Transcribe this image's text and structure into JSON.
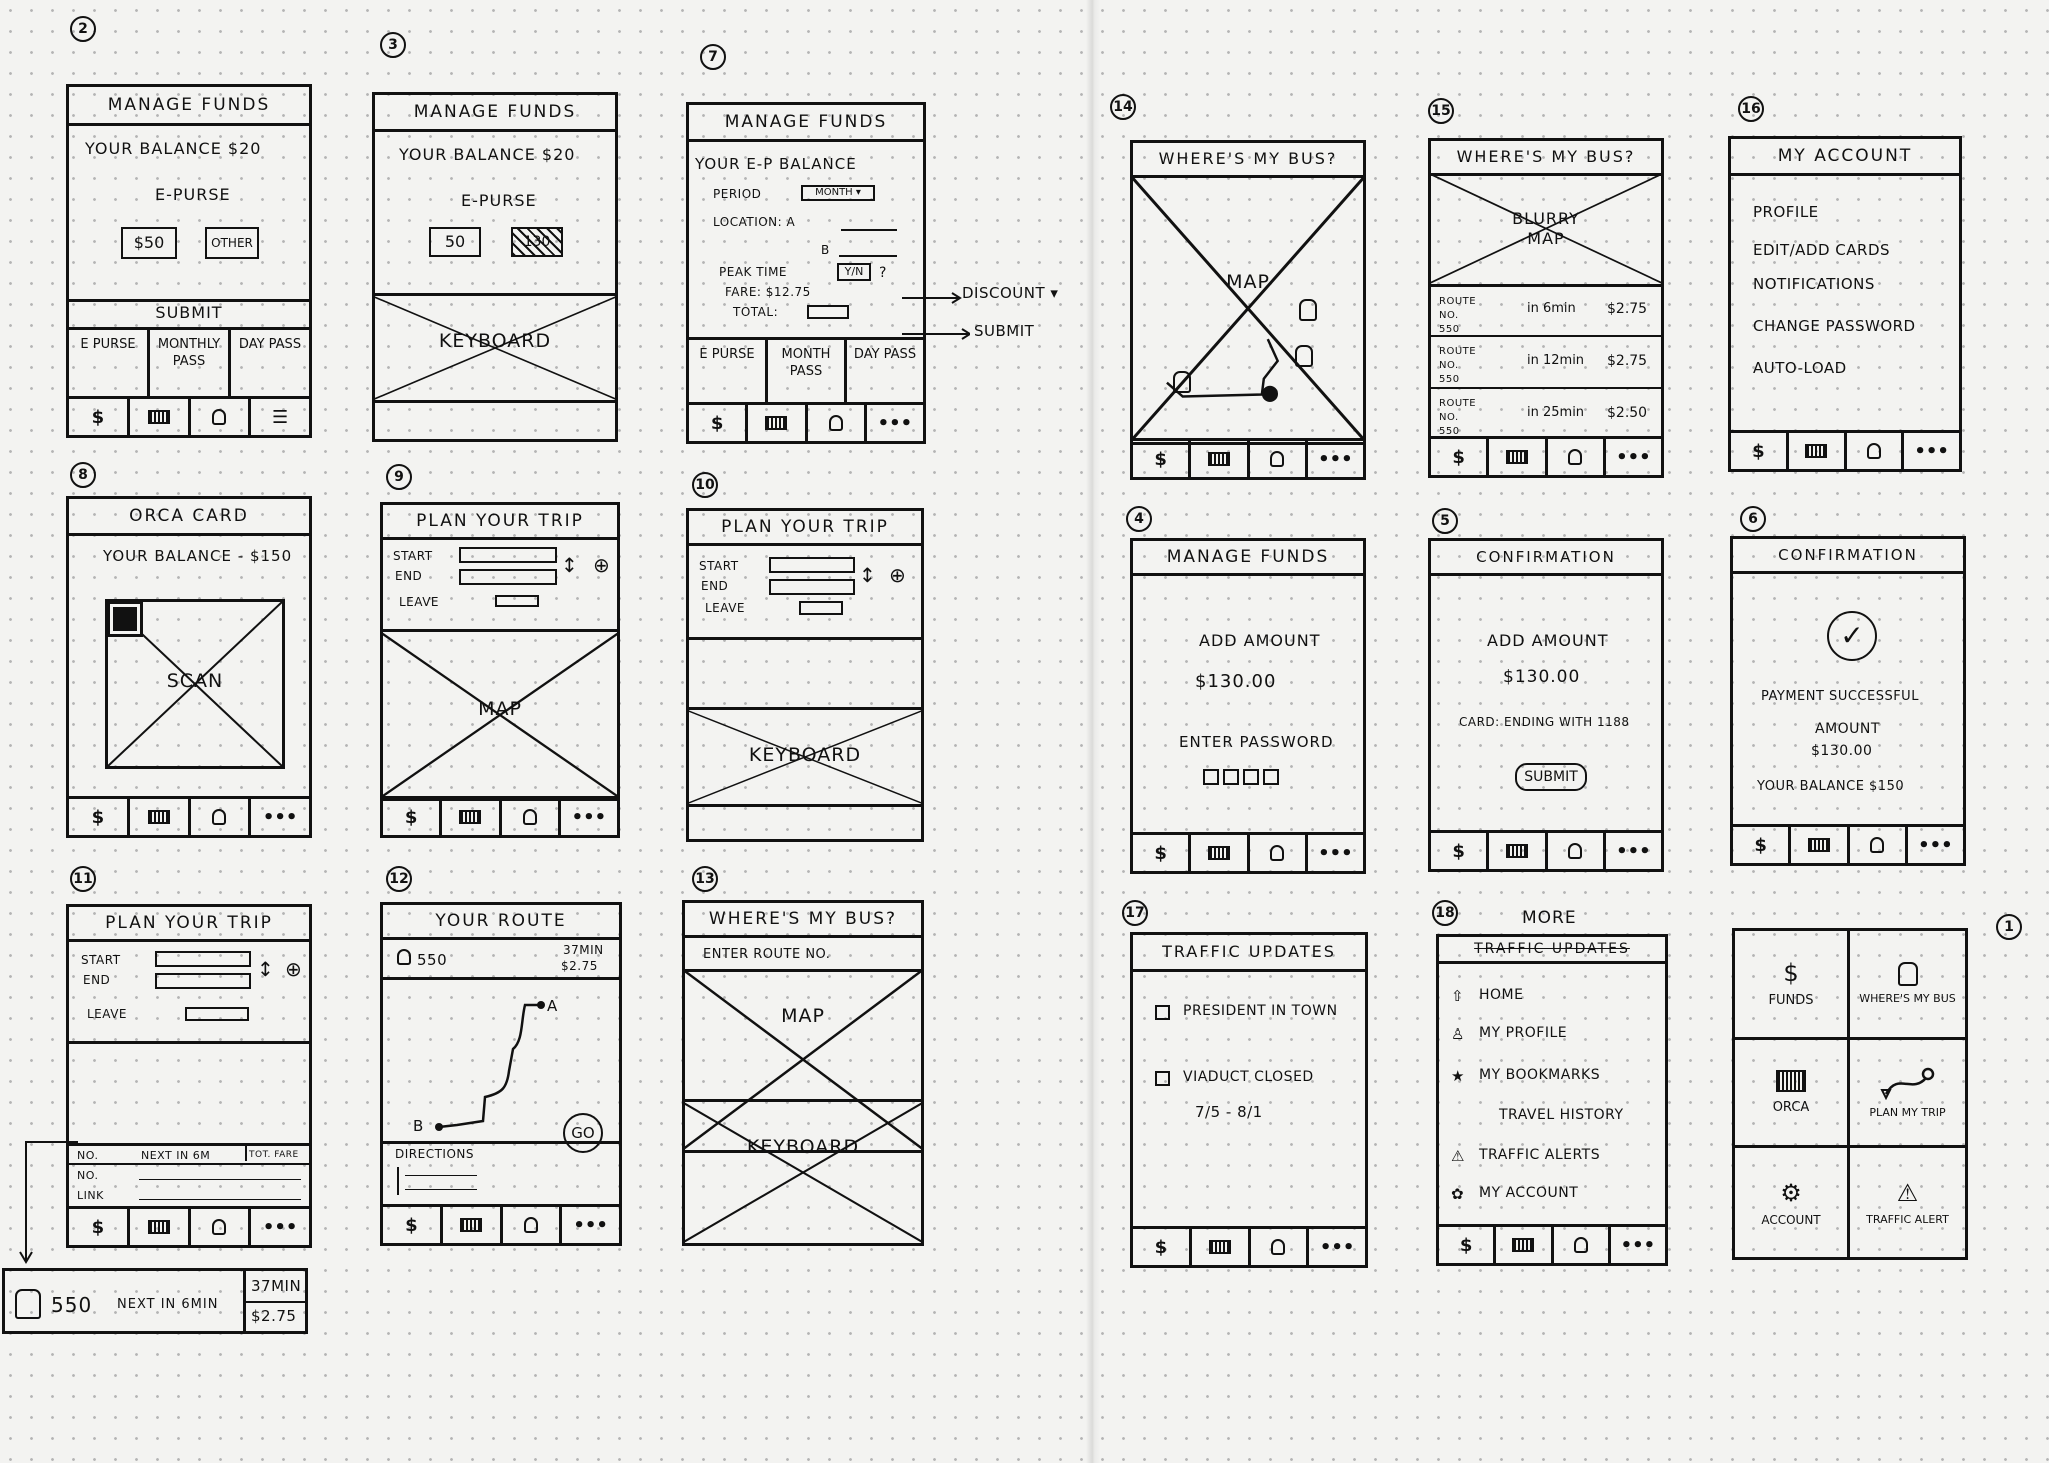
{
  "common": {
    "tab_dollar": "$",
    "tab_more": "•••",
    "manage_funds": "MANAGE FUNDS",
    "wheres_my_bus": "WHERE'S MY BUS?",
    "plan_your_trip": "PLAN YOUR TRIP",
    "start": "START",
    "end": "END",
    "leave": "LEAVE",
    "keyboard": "KEYBOARD",
    "map": "MAP",
    "e_purse": "E PURSE",
    "monthly_pass": "MONTHLY PASS",
    "month_pass": "MONTH PASS",
    "day_pass": "DAY PASS",
    "confirmation": "CONFIRMATION",
    "add_amount": "ADD AMOUNT",
    "amount_value": "$130.00",
    "plus": "⊕",
    "updown": "↕"
  },
  "s1": {
    "num": "1",
    "funds": "FUNDS",
    "wheres_my_bus": "WHERE'S MY BUS",
    "orca": "ORCA",
    "plan_my_trip": "PLAN MY TRIP",
    "account": "ACCOUNT",
    "traffic_alert": "TRAFFIC ALERT"
  },
  "s2": {
    "num": "2",
    "balance": "YOUR BALANCE $20",
    "e_purse": "E-PURSE",
    "opt1": "$50",
    "opt2": "OTHER",
    "submit": "SUBMIT"
  },
  "s3": {
    "num": "3",
    "balance": "YOUR BALANCE $20",
    "e_purse": "E-PURSE",
    "opt1": "50",
    "opt2": "130"
  },
  "s4": {
    "num": "4",
    "enter_password": "ENTER PASSWORD"
  },
  "s5": {
    "num": "5",
    "card": "CARD: ending with 1188",
    "submit": "SUBMIT"
  },
  "s6": {
    "num": "6",
    "success": "PAYMENT SUCCESSFUL",
    "amount": "AMOUNT",
    "balance": "YOUR BALANCE $150"
  },
  "s7": {
    "num": "7",
    "title": "YOUR E-P BALANCE",
    "period": "PERIOD",
    "month": "MONTH ▾",
    "location": "LOCATION: A",
    "b": "B",
    "peak": "PEAK TIME",
    "yn": "Y/N",
    "q": "?",
    "fare": "FARE: $12.75",
    "total": "TOTAL:",
    "discount": "DISCOUNT ▾",
    "submit": "SUBMIT"
  },
  "s8": {
    "num": "8",
    "title": "ORCA CARD",
    "balance": "YOUR BALANCE - $150",
    "scan": "SCAN"
  },
  "s9": {
    "num": "9"
  },
  "s10": {
    "num": "10"
  },
  "s11": {
    "num": "11",
    "c1": "NO.",
    "c2": "NEXT IN 6M",
    "c3": "TOT. FARE",
    "r2": "NO.",
    "r3": "LINK",
    "card_route": "550",
    "card_next": "NEXT IN 6MIN",
    "card_time": "37MIN",
    "card_fare": "$2.75"
  },
  "s12": {
    "num": "12",
    "title": "YOUR ROUTE",
    "route": "550",
    "time": "37min",
    "fare": "$2.75",
    "a": "A",
    "b": "B",
    "go": "GO",
    "directions": "DIRECTIONS"
  },
  "s13": {
    "num": "13",
    "enter_route": "ENTER ROUTE NO."
  },
  "s14": {
    "num": "14"
  },
  "s15": {
    "num": "15",
    "blurry": "BLURRY",
    "map": "MAP",
    "rows": [
      {
        "route": "ROUTE NO. 550",
        "eta": "in 6min",
        "fare": "$2.75"
      },
      {
        "route": "ROUTE NO. 550",
        "eta": "in 12min",
        "fare": "$2.75"
      },
      {
        "route": "ROUTE NO. 550",
        "eta": "in 25min",
        "fare": "$2.50"
      }
    ]
  },
  "s16": {
    "num": "16",
    "title": "MY ACCOUNT",
    "items": [
      "PROFILE",
      "EDIT/ADD CARDS",
      "NOTIFICATIONS",
      "CHANGE PASSWORD",
      "AUTO-LOAD"
    ]
  },
  "s17": {
    "num": "17",
    "title": "TRAFFIC UPDATES",
    "item1": "PRESIDENT IN TOWN",
    "item2": "VIADUCT CLOSED",
    "dates": "7/5 - 8/1"
  },
  "s18": {
    "num": "18",
    "more": "MORE",
    "struck": "TRAFFIC UPDATES",
    "items": [
      {
        "icon": "⇧",
        "label": "HOME"
      },
      {
        "icon": "♙",
        "label": "MY PROFILE"
      },
      {
        "icon": "★",
        "label": "MY BOOKMARKS"
      },
      {
        "icon": "",
        "label": "TRAVEL HISTORY"
      },
      {
        "icon": "⚠",
        "label": "TRAFFIC ALERTS"
      },
      {
        "icon": "✿",
        "label": "MY ACCOUNT"
      }
    ]
  }
}
